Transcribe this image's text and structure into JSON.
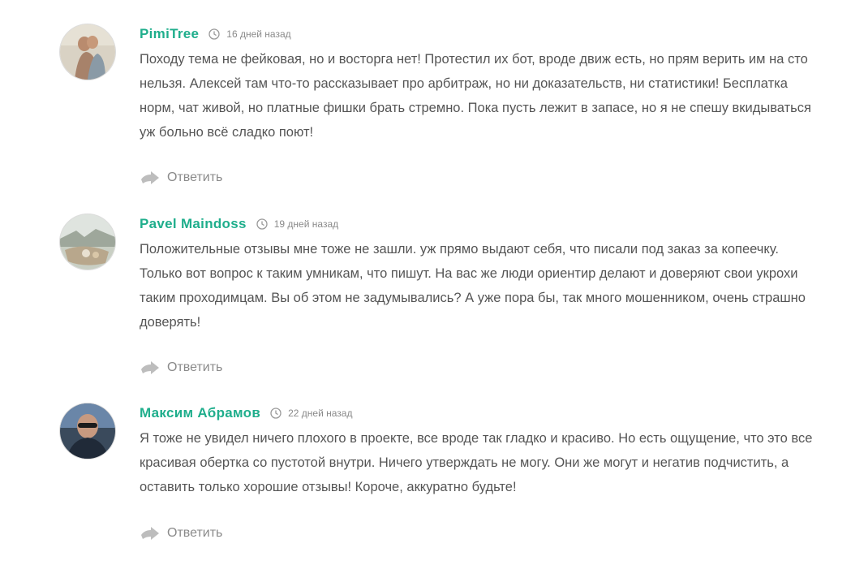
{
  "comments": [
    {
      "author": "PimiTree",
      "date": "16 дней назад",
      "text": "Походу тема не фейковая, но и восторга нет! Протестил их бот, вроде движ есть, но прям верить им на сто нельзя. Алексей там что-то рассказывает про арбитраж, но ни доказательств, ни статистики! Бесплатка норм, чат живой, но платные фишки брать стремно. Пока пусть лежит в запасе, но я не спешу вкидываться уж больно всё сладко поют!",
      "reply_label": "Ответить"
    },
    {
      "author": "Pavel Maindoss",
      "date": "19 дней назад",
      "text": "Положительные отзывы мне тоже не зашли. уж прямо выдают себя, что писали под заказ за копеечку. Только вот вопрос к таким умникам, что пишут. На вас же люди ориентир делают и доверяют свои укрохи таким проходимцам. Вы об этом не задумывались? А уже пора бы, так много мошенником, очень страшно доверять!",
      "reply_label": "Ответить"
    },
    {
      "author": "Максим Абрамов",
      "date": "22 дней назад",
      "text": "Я тоже не увидел ничего плохого в проекте, все вроде так гладко и красиво. Но есть ощущение, что это все красивая обертка со пустотой внутри. Ничего утверждать не могу. Они же могут и негатив подчистить, а оставить только хорошие отзывы! Короче, аккуратно будьте!",
      "reply_label": "Ответить"
    }
  ],
  "colors": {
    "author": "#1fae8c",
    "text": "#555555",
    "muted": "#8a8a8a"
  },
  "icons": {
    "date": "clock-icon",
    "reply": "reply-arrow-icon"
  }
}
